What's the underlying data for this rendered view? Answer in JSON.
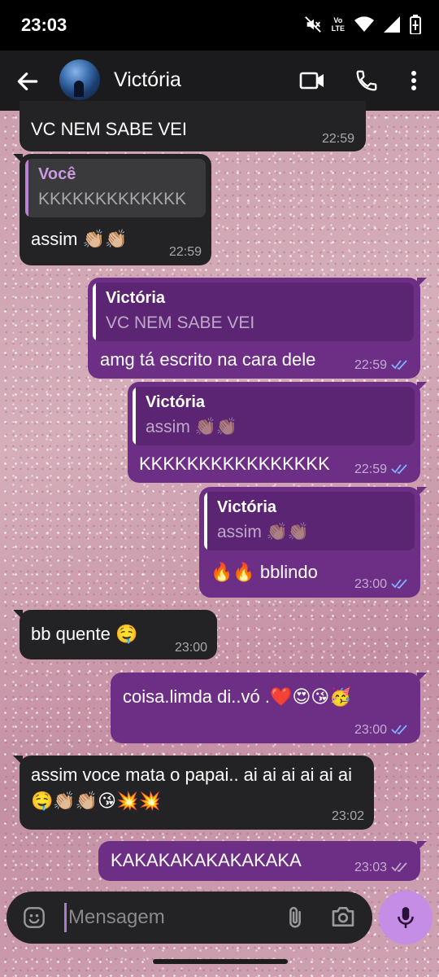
{
  "status_bar": {
    "time": "23:03",
    "volte_top": "Vo",
    "volte_bottom": "LTE"
  },
  "header": {
    "contact_name": "Victória"
  },
  "messages": [
    {
      "id": "m1",
      "direction": "in",
      "text": "VC NEM SABE VEI",
      "time": "22:59"
    },
    {
      "id": "m2",
      "direction": "in",
      "quote_name": "Você",
      "quote_text": "KKKKKKKKKKKKK",
      "text": "assim 👏🏼👏🏼",
      "time": "22:59"
    },
    {
      "id": "m3",
      "direction": "out",
      "quote_name": "Victória",
      "quote_text": "VC NEM SABE VEI",
      "text": "amg tá escrito na cara dele",
      "time": "22:59",
      "status": "read"
    },
    {
      "id": "m4",
      "direction": "out",
      "quote_name": "Victória",
      "quote_text": "assim 👏🏼👏🏼",
      "text": "KKKKKKKKKKKKKKKK",
      "time": "22:59",
      "status": "read"
    },
    {
      "id": "m5",
      "direction": "out",
      "quote_name": "Victória",
      "quote_text": "assim 👏🏼👏🏼",
      "text": "🔥🔥 bblindo",
      "time": "23:00",
      "status": "read"
    },
    {
      "id": "m6",
      "direction": "in",
      "text": "bb quente 🤤",
      "time": "23:00"
    },
    {
      "id": "m7",
      "direction": "out",
      "text": "coisa.limda di..vó .❤️😍😘🥳",
      "time": "23:00",
      "status": "read"
    },
    {
      "id": "m8",
      "direction": "in",
      "text": "assim voce mata o papai.. ai ai ai ai ai ai 🤤👏🏼👏🏼😘💥💥",
      "time": "23:02"
    },
    {
      "id": "m9",
      "direction": "out",
      "text": "KAKAKAKAKAKAKAKA",
      "time": "23:03",
      "status": "delivered"
    }
  ],
  "composer": {
    "placeholder": "Mensagem"
  },
  "colors": {
    "incoming_bubble": "#232325",
    "outgoing_bubble": "#6d2f86",
    "read_ticks": "#7fb2ff",
    "mic_button": "#c58de6"
  }
}
